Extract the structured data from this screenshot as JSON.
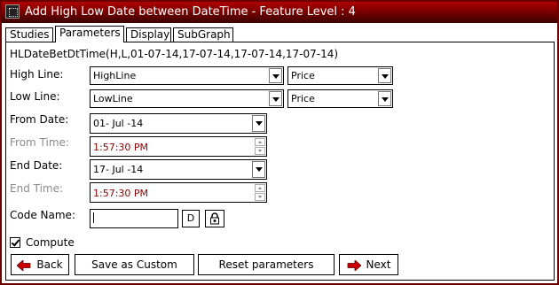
{
  "window": {
    "title": "Add High Low Date between DateTime - Feature Level : 4"
  },
  "tabs": [
    {
      "label": "Studies",
      "active": false
    },
    {
      "label": "Parameters",
      "active": true
    },
    {
      "label": "Display",
      "active": false
    },
    {
      "label": "SubGraph",
      "active": false
    }
  ],
  "expression": "HLDateBetDtTime(H,L,01-07-14,17-07-14,17-07-14,17-07-14)",
  "high_line": {
    "label": "High Line:",
    "value": "HighLine",
    "source": "Price"
  },
  "low_line": {
    "label": "Low Line:",
    "value": "LowLine",
    "source": "Price"
  },
  "from_date": {
    "label": "From Date:",
    "value": "01- Jul -14"
  },
  "from_time": {
    "label": "From Time:",
    "value": "1:57:30 PM",
    "enabled": false
  },
  "end_date": {
    "label": "End Date:",
    "value": "17- Jul -14"
  },
  "end_time": {
    "label": "End Time:",
    "value": "1:57:30 PM",
    "enabled": false
  },
  "code_name": {
    "label": "Code Name:",
    "value": "",
    "d_button": "D"
  },
  "compute": {
    "label": "Compute",
    "checked": true
  },
  "buttons": {
    "back": "Back",
    "save_custom": "Save as Custom",
    "reset": "Reset parameters",
    "next": "Next"
  },
  "colors": {
    "title_bar": "#8b0000",
    "arrow": "#cc0000",
    "disabled_text": "#8a8a8a",
    "time_value": "#8a0000"
  }
}
